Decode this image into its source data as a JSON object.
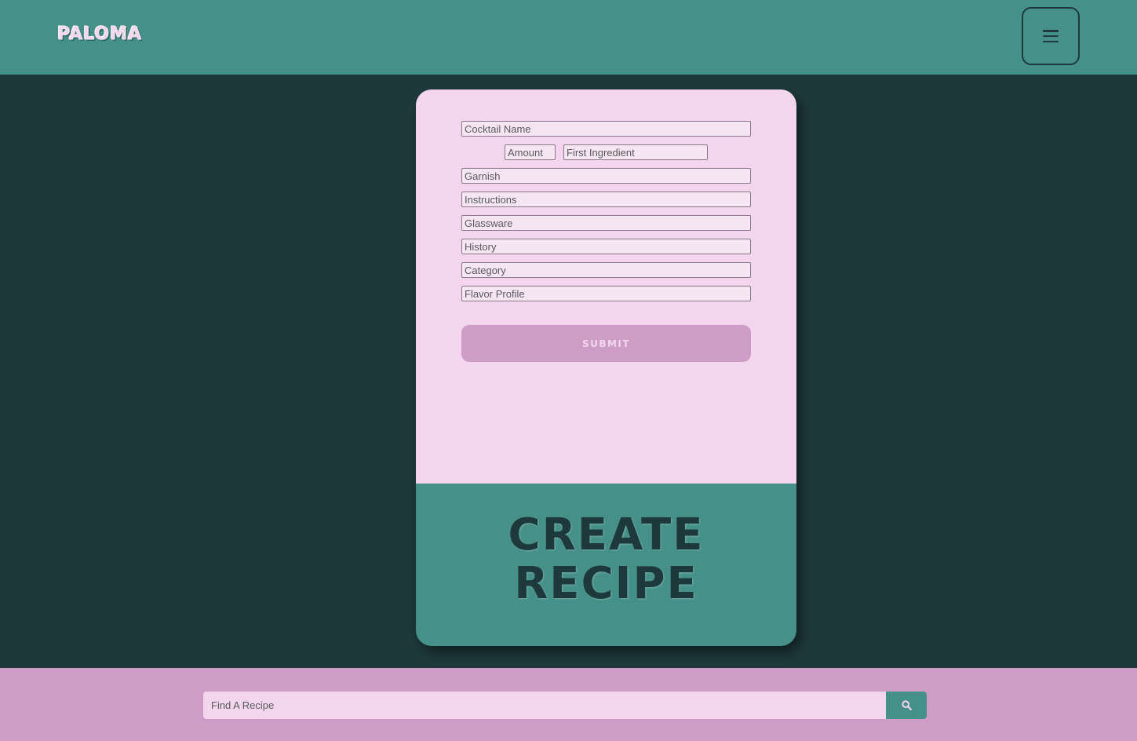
{
  "header": {
    "logo": "PALOMA",
    "menu_icon": "hamburger-menu-icon"
  },
  "form": {
    "cocktail_name_placeholder": "Cocktail Name",
    "amount_placeholder": "Amount",
    "first_ingredient_placeholder": "First Ingredient",
    "garnish_placeholder": "Garnish",
    "instructions_placeholder": "Instructions",
    "glassware_placeholder": "Glassware",
    "history_placeholder": "History",
    "category_placeholder": "Category",
    "flavor_profile_placeholder": "Flavor Profile",
    "submit_label": "SUBMIT"
  },
  "card": {
    "title_line1": "CREATE",
    "title_line2": "RECIPE"
  },
  "footer": {
    "search_placeholder": "Find A Recipe",
    "search_icon": "search-icon"
  },
  "colors": {
    "header_bg": "#459089",
    "page_bg": "#1e393b",
    "card_pink": "#f3d6ee",
    "button_purple": "#cd9dc8"
  }
}
